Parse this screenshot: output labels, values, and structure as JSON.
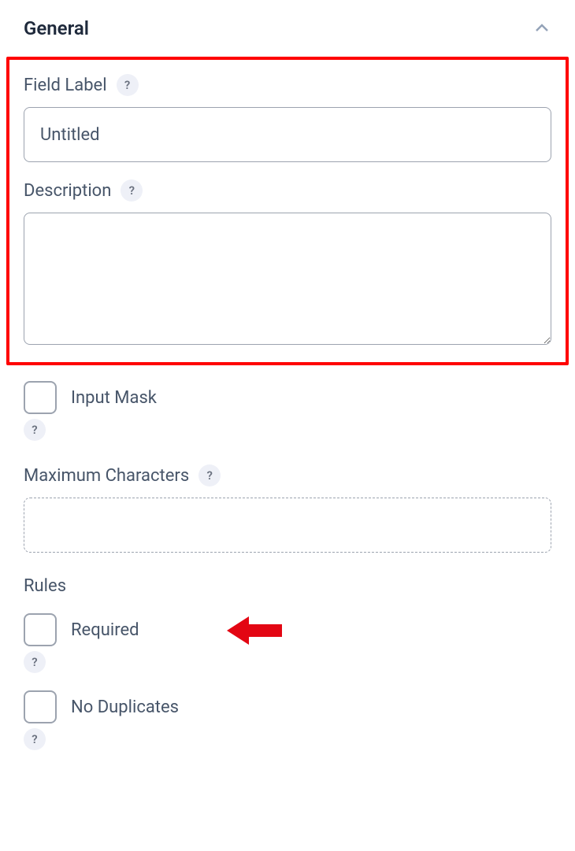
{
  "section": {
    "title": "General"
  },
  "fieldLabel": {
    "label": "Field Label",
    "value": "Untitled"
  },
  "description": {
    "label": "Description",
    "value": ""
  },
  "inputMask": {
    "label": "Input Mask",
    "checked": false
  },
  "maxChars": {
    "label": "Maximum Characters",
    "value": ""
  },
  "rules": {
    "heading": "Rules",
    "required": {
      "label": "Required",
      "checked": false
    },
    "noDuplicates": {
      "label": "No Duplicates",
      "checked": false
    }
  },
  "helpGlyph": "?"
}
